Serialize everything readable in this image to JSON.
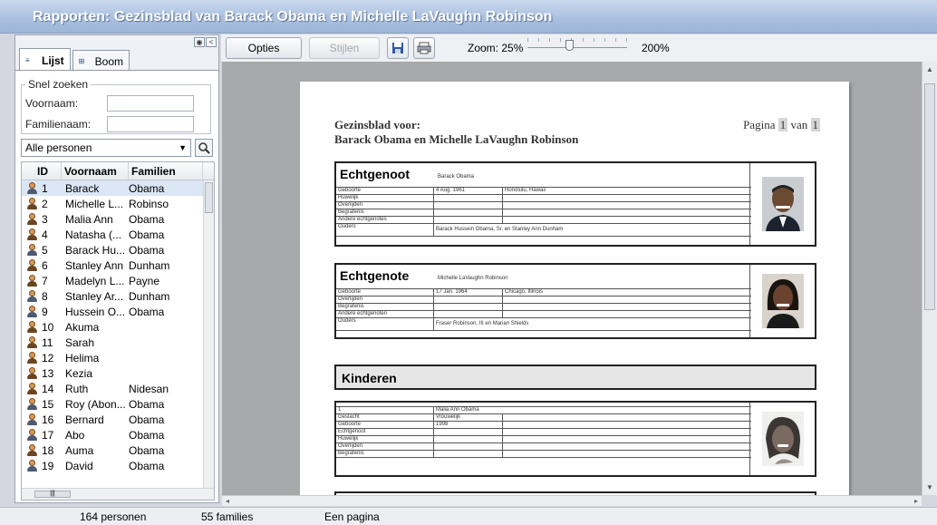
{
  "window": {
    "title": "Rapporten: Gezinsblad van Barack Obama en Michelle LaVaughn Robinson"
  },
  "left": {
    "tabs": [
      {
        "label": "Lijst"
      },
      {
        "label": "Boom"
      }
    ],
    "quick_search": {
      "legend": "Snel zoeken",
      "first_name_label": "Voornaam:",
      "last_name_label": "Familienaam:",
      "first_name_value": "",
      "last_name_value": ""
    },
    "filter": {
      "selected": "Alle personen"
    },
    "columns": [
      "ID",
      "Voornaam",
      "Familien"
    ],
    "rows": [
      {
        "id": "1",
        "first": "Barack",
        "last": "Obama",
        "g": "m"
      },
      {
        "id": "2",
        "first": "Michelle L...",
        "last": "Robinso",
        "g": "f"
      },
      {
        "id": "3",
        "first": "Malia Ann",
        "last": "Obama",
        "g": "f"
      },
      {
        "id": "4",
        "first": "Natasha (...",
        "last": "Obama",
        "g": "f"
      },
      {
        "id": "5",
        "first": "Barack Hu...",
        "last": "Obama",
        "g": "m"
      },
      {
        "id": "6",
        "first": "Stanley Ann",
        "last": "Dunham",
        "g": "f"
      },
      {
        "id": "7",
        "first": "Madelyn L...",
        "last": "Payne",
        "g": "f"
      },
      {
        "id": "8",
        "first": "Stanley Ar...",
        "last": "Dunham",
        "g": "m"
      },
      {
        "id": "9",
        "first": "Hussein O...",
        "last": "Obama",
        "g": "m"
      },
      {
        "id": "10",
        "first": "Akuma",
        "last": "",
        "g": "f"
      },
      {
        "id": "11",
        "first": "Sarah",
        "last": "",
        "g": "f"
      },
      {
        "id": "12",
        "first": "Helima",
        "last": "",
        "g": "f"
      },
      {
        "id": "13",
        "first": "Kezia",
        "last": "",
        "g": "f"
      },
      {
        "id": "14",
        "first": "Ruth",
        "last": "Nidesan",
        "g": "f"
      },
      {
        "id": "15",
        "first": "Roy (Abon...",
        "last": "Obama",
        "g": "m"
      },
      {
        "id": "16",
        "first": "Bernard",
        "last": "Obama",
        "g": "m"
      },
      {
        "id": "17",
        "first": "Abo",
        "last": "Obama",
        "g": "m"
      },
      {
        "id": "18",
        "first": "Auma",
        "last": "Obama",
        "g": "f"
      },
      {
        "id": "19",
        "first": "David",
        "last": "Obama",
        "g": "m"
      }
    ]
  },
  "toolbar": {
    "options_label": "Opties",
    "styles_label": "Stijlen",
    "zoom_min": "Zoom: 25%",
    "zoom_max": "200%",
    "save_icon": "save-icon",
    "print_icon": "print-icon"
  },
  "report": {
    "heading1": "Gezinsblad voor:",
    "heading2": "Barack Obama en Michelle LaVaughn Robinson",
    "page_prefix": "Pagina",
    "page_num": "1",
    "page_mid": "van",
    "page_total": "1",
    "husband": {
      "header": "Echtgenoot",
      "name": "Barack Obama",
      "rows": [
        {
          "label": "Geboorte",
          "date": "4 Aug. 1961",
          "place": "Honolulu, Hawaii"
        },
        {
          "label": "Huwelijk",
          "date": "",
          "place": ""
        },
        {
          "label": "Overlijden",
          "date": "",
          "place": ""
        },
        {
          "label": "Begrafenis",
          "date": "",
          "place": ""
        },
        {
          "label": "Andere echtgenotes",
          "date": "",
          "place": ""
        }
      ],
      "parents_label": "Ouders",
      "parents": "Barack Hussein Obama, Sr. en Stanley Ann Dunham"
    },
    "wife": {
      "header": "Echtgenote",
      "name": "Michelle LaVaughn Robinson",
      "rows": [
        {
          "label": "Geboorte",
          "date": "17 Jan. 1964",
          "place": "Chicago, Illinois"
        },
        {
          "label": "Overlijden",
          "date": "",
          "place": ""
        },
        {
          "label": "Begrafenis",
          "date": "",
          "place": ""
        },
        {
          "label": "Andere echtgenoten",
          "date": "",
          "place": ""
        }
      ],
      "parents_label": "Ouders",
      "parents": "Fraser Robinson, III en Marian Shields"
    },
    "children_header": "Kinderen",
    "child1": {
      "num": "1",
      "name": "Malia Ann Obama",
      "rows": [
        {
          "label": "Geslacht",
          "date": "Vrouwelijk",
          "place": ""
        },
        {
          "label": "Geboorte",
          "date": "1998",
          "place": ""
        },
        {
          "label": "Echtgenoot",
          "date": "",
          "place": ""
        },
        {
          "label": "Huwelijk",
          "date": "",
          "place": ""
        },
        {
          "label": "Overlijden",
          "date": "",
          "place": ""
        },
        {
          "label": "Begrafenis",
          "date": "",
          "place": ""
        }
      ]
    }
  },
  "status": {
    "persons": "164 personen",
    "families": "55 families",
    "pages": "Een pagina"
  }
}
